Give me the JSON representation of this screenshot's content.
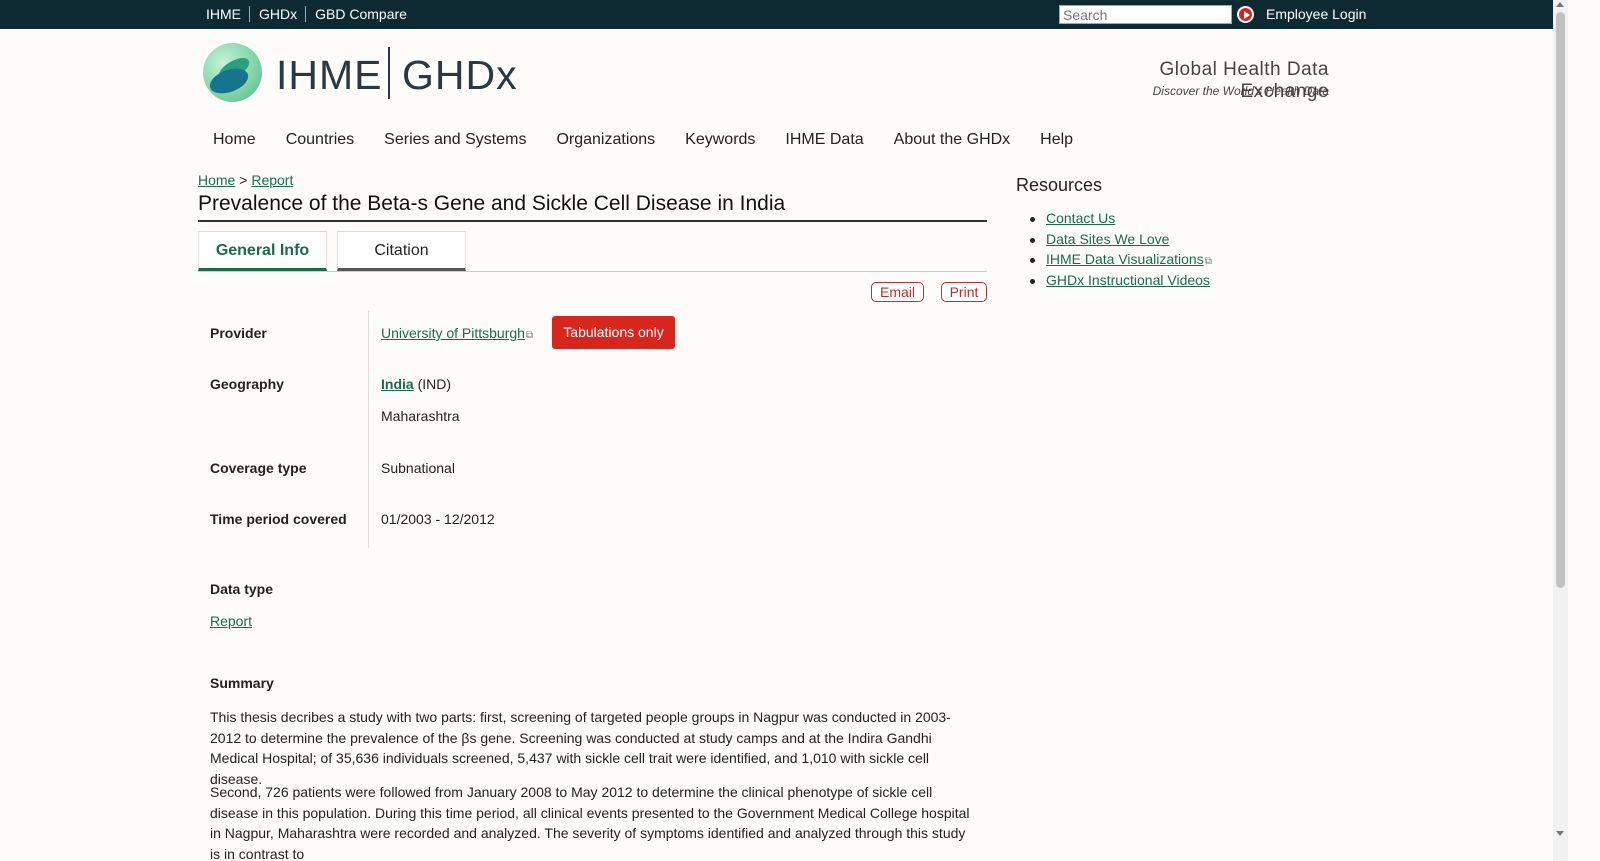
{
  "topbar": {
    "links": [
      "IHME",
      "GHDx",
      "GBD Compare"
    ],
    "search_placeholder": "Search",
    "employee_login": "Employee Login"
  },
  "header": {
    "logo_left": "IHME",
    "logo_right": "GHDx",
    "tagline": "Global Health Data Exchange",
    "subtagline": "Discover the World's Health Data"
  },
  "nav": [
    "Home",
    "Countries",
    "Series and Systems",
    "Organizations",
    "Keywords",
    "IHME Data",
    "About the GHDx",
    "Help"
  ],
  "breadcrumb": {
    "home": "Home",
    "sep": ">",
    "current": "Report"
  },
  "page": {
    "title": "Prevalence of the Beta-s Gene and Sickle Cell Disease in India",
    "tabs": [
      "General Info",
      "Citation"
    ],
    "email": "Email",
    "print": "Print"
  },
  "details": {
    "provider_label": "Provider",
    "provider_value": "University of Pittsburgh",
    "tabulations": "Tabulations only",
    "geography_label": "Geography",
    "geography_country": "India",
    "geography_code": "(IND)",
    "geography_region": "Maharashtra",
    "coverage_label": "Coverage type",
    "coverage_value": "Subnational",
    "time_label": "Time period covered",
    "time_value": "01/2003 - 12/2012",
    "datatype_label": "Data type",
    "datatype_value": "Report",
    "summary_label": "Summary",
    "summary_p1": "This thesis decribes a study with two parts: first, screening of targeted people groups in Nagpur was conducted in 2003-2012 to determine the prevalence of the βs gene. Screening was conducted at study camps and at the Indira Gandhi Medical Hospital; of 35,636 individuals screened, 5,437 with sickle cell trait were identified, and 1,010 with sickle cell disease.",
    "summary_p2": "Second, 726 patients were followed from January 2008 to May 2012 to determine the clinical phenotype of sickle cell disease in this population. During this time period, all clinical events presented to the Government Medical College hospital in Nagpur, Maharashtra were recorded and analyzed. The severity of symptoms identified and analyzed through this study is in contrast to"
  },
  "resources": {
    "title": "Resources",
    "items": [
      "Contact Us",
      "Data Sites We Love",
      "IHME Data Visualizations",
      "GHDx Instructional Videos"
    ]
  },
  "colors": {
    "topbar": "#0d2a33",
    "link": "#1a6b4c",
    "accent_red": "#d7261e"
  }
}
